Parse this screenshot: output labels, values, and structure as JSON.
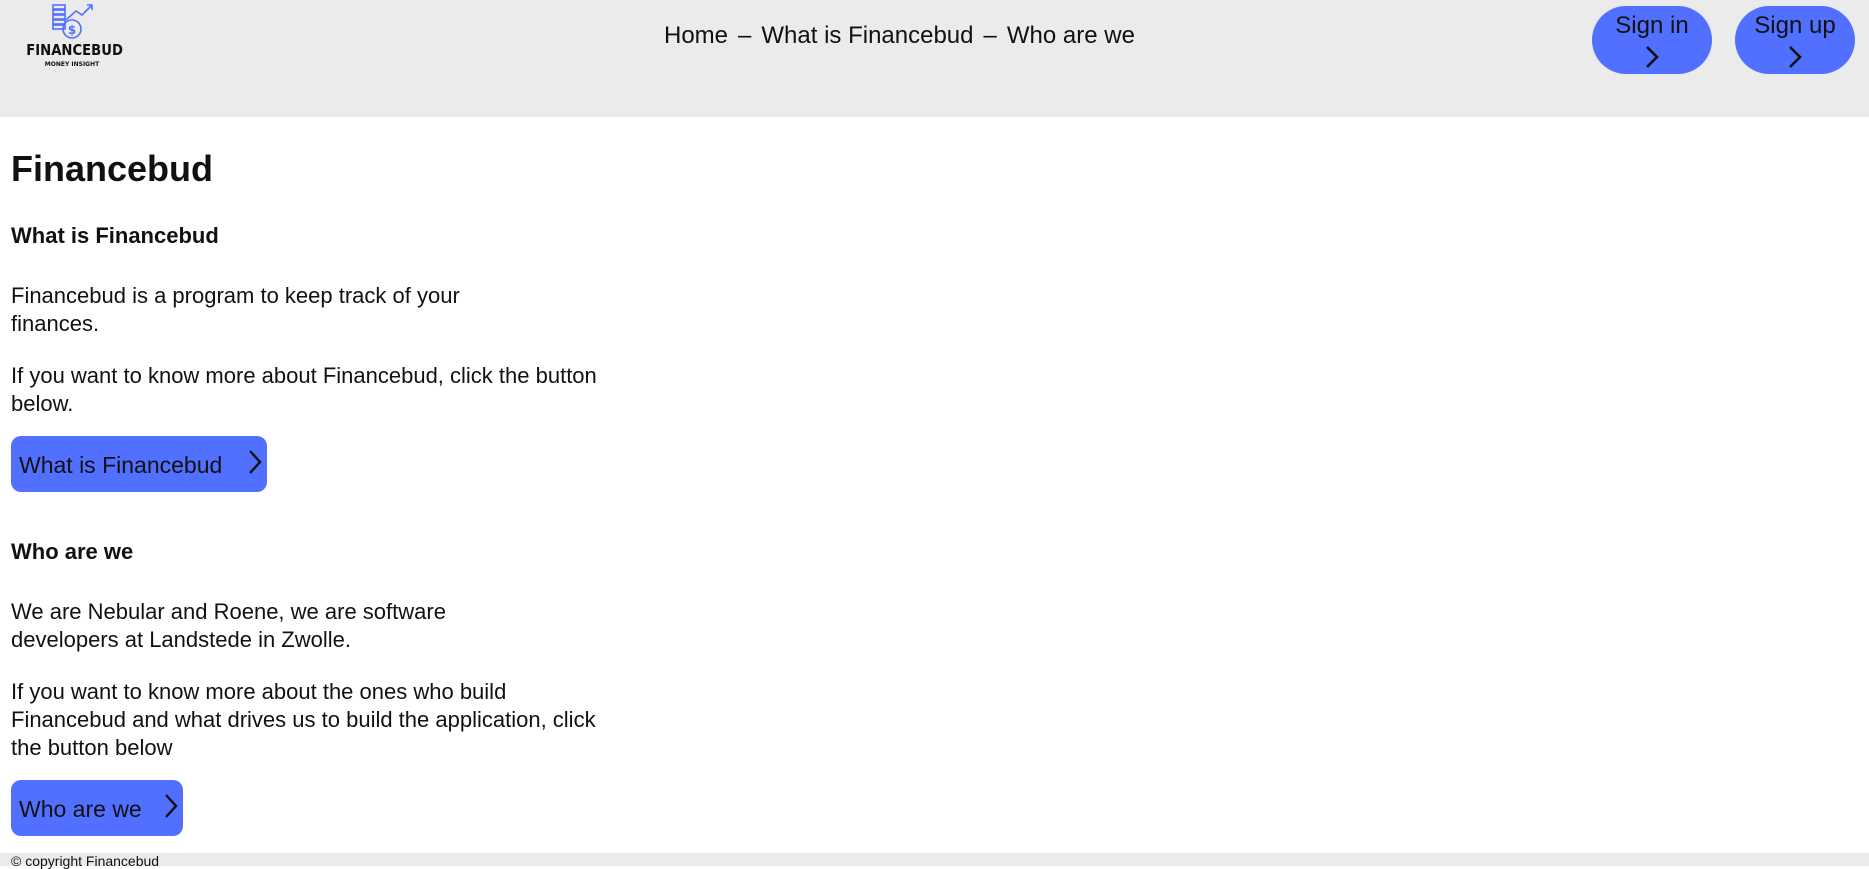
{
  "header": {
    "logo": {
      "brand": "FINANCEBUD",
      "tagline": "MONEY INSIGHT",
      "icon": "coins-growth-icon"
    },
    "nav": {
      "home": "Home",
      "separator": "–",
      "what": "What is Financebud",
      "who": "Who are we"
    },
    "sign_in": "Sign in",
    "sign_up": "Sign up"
  },
  "main": {
    "title": "Financebud",
    "section_what": {
      "heading": "What is Financebud",
      "para1": "Financebud is a program to keep track of your finances.",
      "para2": "If you want to know more about Financebud, click the button below.",
      "button": "What is Financebud"
    },
    "section_who": {
      "heading": "Who are we",
      "para1": "We are Nebular and Roene, we are software developers at Landstede in Zwolle.",
      "para2": "If you want to know more about the ones who build Financebud and what drives us to build the application, click the button below",
      "button": "Who are we"
    }
  },
  "footer": {
    "copyright": "© copyright Financebud"
  },
  "colors": {
    "accent": "#5170ff",
    "header_bg": "#ebebeb",
    "text": "#111111"
  }
}
